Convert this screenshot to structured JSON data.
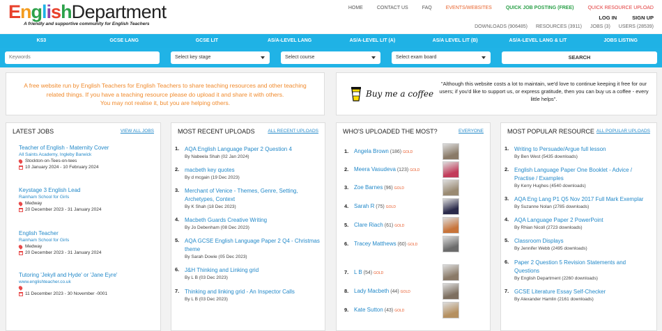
{
  "logo": {
    "english": "English",
    "department": "Department",
    "tagline": "A friendly and supportive community for English Teachers"
  },
  "topnav": {
    "home": "HOME",
    "contact": "CONTACT US",
    "faq": "FAQ",
    "events": "EVENTS/WEBSITES",
    "job_posting": "QUICK JOB POSTING (FREE)",
    "resource_upload": "QUICK RESOURCE UPLOAD"
  },
  "auth": {
    "login": "LOG IN",
    "signup": "SIGN UP"
  },
  "stats": {
    "downloads": "DOWNLOADS (906485)",
    "resources": "RESOURCES (3911)",
    "jobs": "JOBS (3)",
    "users": "USERS (28539)"
  },
  "categories": [
    "KS3",
    "GCSE LANG",
    "GCSE LIT",
    "AS/A-LEVEL LANG",
    "AS/A-LEVEL LIT (A)",
    "AS/A LEVEL LIT (B)",
    "AS/A-LEVEL LANG & LIT",
    "JOBS LISTING"
  ],
  "filters": {
    "keywords_placeholder": "Keywords",
    "key_stage": "Select key stage",
    "course": "Select course",
    "exam_board": "Select exam board",
    "search": "SEARCH"
  },
  "banner": {
    "left_line1": "A free website run by English Teachers for English Teachers to share teaching resources and other teaching",
    "left_line2": "related things. If you have a teaching resource please do upload it and share it with others.",
    "left_line3": "You may not realise it, but you are helping others.",
    "coffee": "Buy me a coffee",
    "quote": "\"Although this website costs a lot to maintain, we'd love to continue keeping it free for our users; if you'd like to support us, or express gratitude, then you can buy us a coffee - every little helps\"."
  },
  "jobs": {
    "heading": "LATEST JOBS",
    "view_all": "VIEW ALL JOBS",
    "items": [
      {
        "title": "Teacher of English - Maternity Cover",
        "school": "All Saints Academy, Ingleby Barwick",
        "location": "Stockton-on-Tees-on-tees",
        "dates": "10 January 2024 - 10 February 2024"
      },
      {
        "title": "Keystage 3 English Lead",
        "school": "Rainham School for Girls",
        "location": "Medway",
        "dates": "20 December 2023 - 31 January 2024"
      },
      {
        "title": "English Teacher",
        "school": "Rainham School for Girls",
        "location": "Medway",
        "dates": "20 December 2023 - 31 January 2024"
      },
      {
        "title": "Tutoring 'Jekyll and Hyde' or 'Jane Eyre'",
        "school": "www.englishteacher.co.uk",
        "location": "",
        "dates": "11 December 2023 - 30 November -0001"
      }
    ]
  },
  "uploads": {
    "heading": "MOST RECENT UPLOADS",
    "view_all": "ALL RECENT UPLOADS",
    "items": [
      {
        "n": "1.",
        "line1": "AQA English Language Paper 2 Question 4",
        "line2": "",
        "by": "By Nabeela Shah (02 Jan 2024)"
      },
      {
        "n": "2.",
        "line1": "macbeth key quotes",
        "line2": "",
        "by": "By d mcgain (19 Dec 2023)"
      },
      {
        "n": "3.",
        "line1": "Merchant of Venice - Themes, Genre, Setting,",
        "line2": "Archetypes, Context",
        "by": "By K Shah (18 Dec 2023)"
      },
      {
        "n": "4.",
        "line1": "Macbeth Guards Creative Writing",
        "line2": "",
        "by": "By Jo Debenham (08 Dec 2023)"
      },
      {
        "n": "5.",
        "line1": "AQA GCSE English Language Paper 2 Q4 - Christmas",
        "line2": "theme",
        "by": "By Sarah Dowie (05 Dec 2023)"
      },
      {
        "n": "6.",
        "line1": "J&H Thinking and Linking grid",
        "line2": "",
        "by": "By L B (03 Dec 2023)"
      },
      {
        "n": "7.",
        "line1": "Thinking and linking grid - An Inspector Calls",
        "line2": "",
        "by": "By L B (03 Dec 2023)"
      }
    ]
  },
  "uploaders": {
    "heading": "WHO'S UPLOADED THE MOST?",
    "view_all": "EVERYONE",
    "gold": "GOLD",
    "items": [
      {
        "n": "1.",
        "name": "Angela Brown",
        "count": "(186)"
      },
      {
        "n": "2.",
        "name": "Meera Vasudeva",
        "count": "(123)"
      },
      {
        "n": "3.",
        "name": "Zoe Barnes",
        "count": "(96)"
      },
      {
        "n": "4.",
        "name": "Sarah R",
        "count": "(75)"
      },
      {
        "n": "5.",
        "name": "Clare Riach",
        "count": "(61)"
      },
      {
        "n": "6.",
        "name": "Tracey Matthews",
        "count": "(60)"
      },
      {
        "n": "7.",
        "name": "L B",
        "count": "(54)"
      },
      {
        "n": "8.",
        "name": "Lady Macbeth",
        "count": "(44)"
      },
      {
        "n": "9.",
        "name": "Kate Sutton",
        "count": "(43)"
      }
    ]
  },
  "popular": {
    "heading": "MOST POPULAR RESOURCE",
    "view_all": "ALL POPULAR UPLOADS",
    "items": [
      {
        "n": "1.",
        "line1": "Writing to Persuade/Argue full lesson",
        "line2": "",
        "by": "By Ben West (5435 downloads)"
      },
      {
        "n": "2.",
        "line1": "English Language Paper One Booklet - Advice /",
        "line2": "Practise / Examples",
        "by": "By Kerry Hughes (4540 downloads)"
      },
      {
        "n": "3.",
        "line1": "AQA Eng Lang P1 Q5 Nov 2017 Full Mark Exemplar",
        "line2": "",
        "by": "By Suzanne Nolan (2785 downloads)"
      },
      {
        "n": "4.",
        "line1": "AQA Language Paper 2 PowerPoint",
        "line2": "",
        "by": "By Rhian Nicoll (2723 downloads)"
      },
      {
        "n": "5.",
        "line1": "Classroom Displays",
        "line2": "",
        "by": "By Jennifer Webb (2495 downloads)"
      },
      {
        "n": "6.",
        "line1": "Paper 2 Question 5 Revision Statements and",
        "line2": "Questions",
        "by": "By English Department (2260 downloads)"
      },
      {
        "n": "7.",
        "line1": "GCSE Literature Essay Self-Checker",
        "line2": "",
        "by": "By Alexander Hamlin (2161 downloads)"
      }
    ]
  }
}
